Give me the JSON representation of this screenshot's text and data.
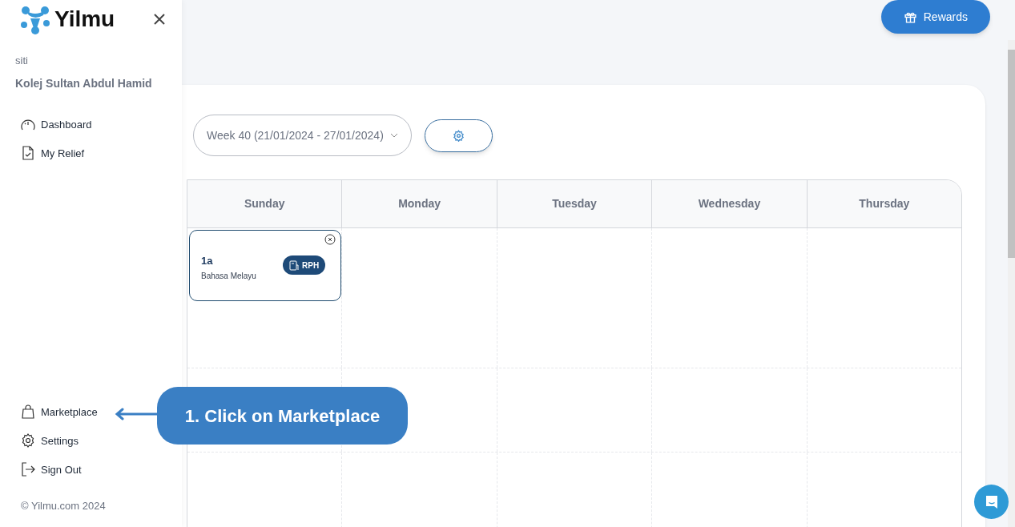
{
  "sidebar": {
    "logo": "Yilmu",
    "user": "siti",
    "school": "Kolej Sultan Abdul Hamid",
    "nav_top": [
      {
        "label": "Dashboard"
      },
      {
        "label": "My Relief"
      }
    ],
    "nav_bottom": [
      {
        "label": "Marketplace"
      },
      {
        "label": "Settings"
      },
      {
        "label": "Sign Out"
      }
    ],
    "footer": "© Yilmu.com 2024"
  },
  "header": {
    "rewards": "Rewards"
  },
  "week_select": {
    "value": "Week 40 (21/01/2024 - 27/01/2024)"
  },
  "calendar": {
    "days": [
      {
        "label": "Sunday",
        "events": [
          {
            "class_name": "1a",
            "subject": "Bahasa Melayu",
            "badge": "RPH"
          }
        ]
      },
      {
        "label": "Monday"
      },
      {
        "label": "Tuesday"
      },
      {
        "label": "Wednesday"
      },
      {
        "label": "Thursday"
      }
    ]
  },
  "callout": {
    "text": "1. Click on Marketplace"
  }
}
